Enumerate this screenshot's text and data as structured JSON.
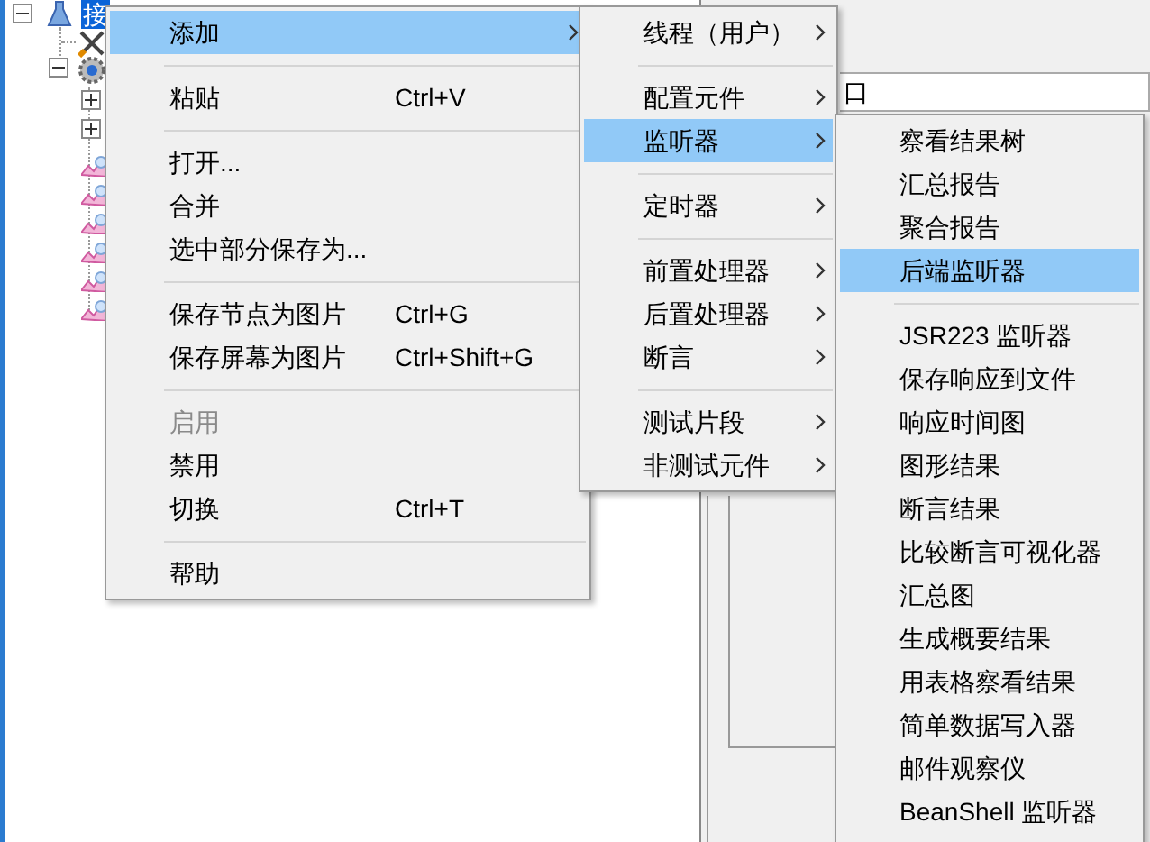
{
  "tree": {
    "label": "接",
    "selected": true
  },
  "panel": {
    "field_value": "口"
  },
  "context_menu": {
    "items": [
      {
        "kind": "item",
        "label": "添加",
        "submenu": true,
        "selected": true,
        "disabled": false
      },
      {
        "kind": "separator"
      },
      {
        "kind": "item",
        "label": "粘贴",
        "shortcut": "Ctrl+V",
        "submenu": false,
        "selected": false,
        "disabled": false
      },
      {
        "kind": "separator"
      },
      {
        "kind": "item",
        "label": "打开...",
        "submenu": false,
        "selected": false,
        "disabled": false
      },
      {
        "kind": "item",
        "label": "合并",
        "submenu": false,
        "selected": false,
        "disabled": false
      },
      {
        "kind": "item",
        "label": "选中部分保存为...",
        "submenu": false,
        "selected": false,
        "disabled": false
      },
      {
        "kind": "separator"
      },
      {
        "kind": "item",
        "label": "保存节点为图片",
        "shortcut": "Ctrl+G",
        "submenu": false,
        "selected": false,
        "disabled": false
      },
      {
        "kind": "item",
        "label": "保存屏幕为图片",
        "shortcut": "Ctrl+Shift+G",
        "submenu": false,
        "selected": false,
        "disabled": false
      },
      {
        "kind": "separator"
      },
      {
        "kind": "item",
        "label": "启用",
        "submenu": false,
        "selected": false,
        "disabled": true
      },
      {
        "kind": "item",
        "label": "禁用",
        "submenu": false,
        "selected": false,
        "disabled": false
      },
      {
        "kind": "item",
        "label": "切换",
        "shortcut": "Ctrl+T",
        "submenu": false,
        "selected": false,
        "disabled": false
      },
      {
        "kind": "separator"
      },
      {
        "kind": "item",
        "label": "帮助",
        "submenu": false,
        "selected": false,
        "disabled": false
      }
    ]
  },
  "add_submenu": {
    "items": [
      {
        "kind": "item",
        "label": "线程（用户）",
        "submenu": true,
        "selected": false
      },
      {
        "kind": "separator"
      },
      {
        "kind": "item",
        "label": "配置元件",
        "submenu": true,
        "selected": false
      },
      {
        "kind": "item",
        "label": "监听器",
        "submenu": true,
        "selected": true
      },
      {
        "kind": "separator"
      },
      {
        "kind": "item",
        "label": "定时器",
        "submenu": true,
        "selected": false
      },
      {
        "kind": "separator"
      },
      {
        "kind": "item",
        "label": "前置处理器",
        "submenu": true,
        "selected": false
      },
      {
        "kind": "item",
        "label": "后置处理器",
        "submenu": true,
        "selected": false
      },
      {
        "kind": "item",
        "label": "断言",
        "submenu": true,
        "selected": false
      },
      {
        "kind": "separator"
      },
      {
        "kind": "item",
        "label": "测试片段",
        "submenu": true,
        "selected": false
      },
      {
        "kind": "item",
        "label": "非测试元件",
        "submenu": true,
        "selected": false
      }
    ]
  },
  "listener_submenu": {
    "items": [
      {
        "kind": "item",
        "label": "察看结果树",
        "selected": false
      },
      {
        "kind": "item",
        "label": "汇总报告",
        "selected": false
      },
      {
        "kind": "item",
        "label": "聚合报告",
        "selected": false
      },
      {
        "kind": "item",
        "label": "后端监听器",
        "selected": true
      },
      {
        "kind": "separator"
      },
      {
        "kind": "item",
        "label": "JSR223 监听器",
        "selected": false
      },
      {
        "kind": "item",
        "label": "保存响应到文件",
        "selected": false
      },
      {
        "kind": "item",
        "label": "响应时间图",
        "selected": false
      },
      {
        "kind": "item",
        "label": "图形结果",
        "selected": false
      },
      {
        "kind": "item",
        "label": "断言结果",
        "selected": false
      },
      {
        "kind": "item",
        "label": "比较断言可视化器",
        "selected": false
      },
      {
        "kind": "item",
        "label": "汇总图",
        "selected": false
      },
      {
        "kind": "item",
        "label": "生成概要结果",
        "selected": false
      },
      {
        "kind": "item",
        "label": "用表格察看结果",
        "selected": false
      },
      {
        "kind": "item",
        "label": "简单数据写入器",
        "selected": false
      },
      {
        "kind": "item",
        "label": "邮件观察仪",
        "selected": false
      },
      {
        "kind": "item",
        "label": "BeanShell 监听器",
        "selected": false
      }
    ]
  }
}
